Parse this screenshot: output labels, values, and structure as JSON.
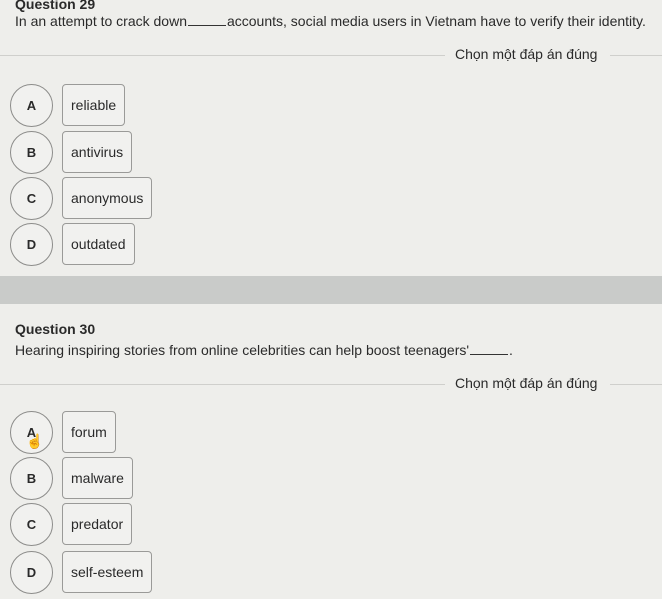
{
  "questions": [
    {
      "title": "Question 29",
      "text_before": "In an attempt to crack down",
      "text_after": "accounts, social media users in Vietnam have to verify their identity.",
      "prompt": "Chọn một đáp án đúng",
      "options": [
        {
          "letter": "A",
          "text": "reliable"
        },
        {
          "letter": "B",
          "text": "antivirus"
        },
        {
          "letter": "C",
          "text": "anonymous"
        },
        {
          "letter": "D",
          "text": "outdated"
        }
      ]
    },
    {
      "title": "Question 30",
      "text_before": "Hearing inspiring stories from online celebrities can help boost teenagers'",
      "text_after": ".",
      "prompt": "Chọn một đáp án đúng",
      "options": [
        {
          "letter": "A",
          "text": "forum"
        },
        {
          "letter": "B",
          "text": "malware"
        },
        {
          "letter": "C",
          "text": "predator"
        },
        {
          "letter": "D",
          "text": "self-esteem"
        }
      ]
    }
  ],
  "cursor_icon": "hand-pointer-icon"
}
